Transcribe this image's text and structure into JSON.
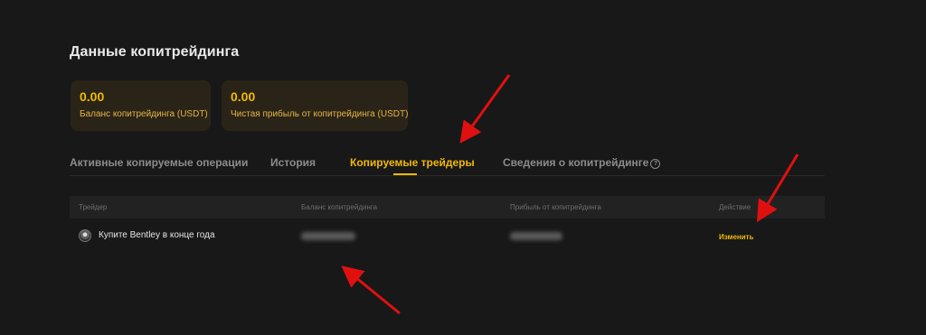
{
  "page": {
    "title": "Данные копитрейдинга"
  },
  "summary_cards": [
    {
      "value": "0.00",
      "label": "Баланс копитрейдинга (USDT)"
    },
    {
      "value": "0.00",
      "label": "Чистая прибыль от копитрейдинга (USDT)"
    }
  ],
  "tabs": [
    {
      "label": "Активные копируемые операции"
    },
    {
      "label": "История"
    },
    {
      "label": "Копируемые трейдеры"
    },
    {
      "label": "Сведения о копитрейдинге"
    }
  ],
  "table": {
    "headers": [
      "Трейдер",
      "Баланс копитрейдинга",
      "Прибыль от копитрейдинга",
      "Действие"
    ],
    "rows": [
      {
        "trader": "Купите Bentley в конце года",
        "action": "Изменить"
      }
    ]
  },
  "colors": {
    "accent": "#f0b90b",
    "background": "#181818",
    "annotation_arrow": "#e01010"
  },
  "icons": {
    "help": "?"
  }
}
